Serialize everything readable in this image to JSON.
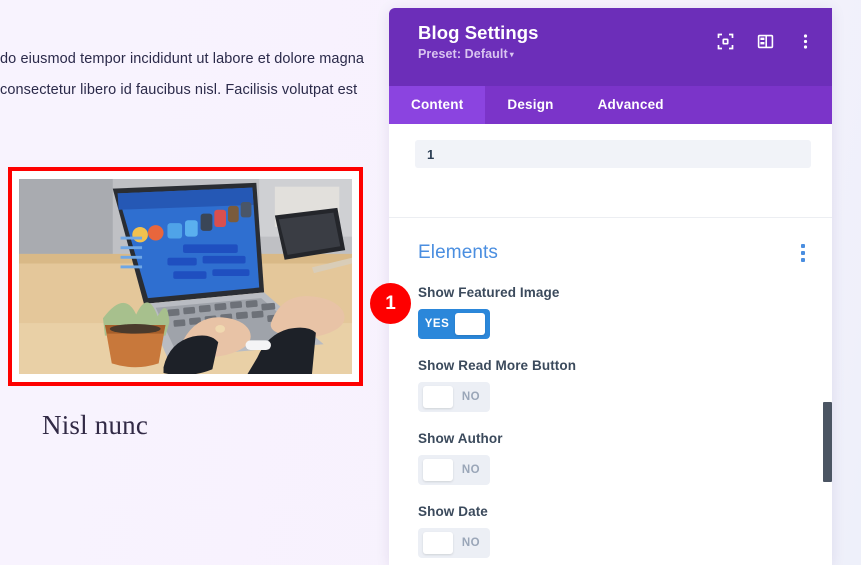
{
  "page": {
    "body_text_lines": [
      "do eiusmod tempor incididunt ut labore et dolore magna",
      "consectetur libero id faucibus nisl. Facilisis volutpat est"
    ],
    "post_title": "Nisl nunc",
    "featured_image_alt": "Person typing on a laptop at a wooden desk with a small potted succulent and a smartphone",
    "highlight_border_color": "#fe0000"
  },
  "panel": {
    "title": "Blog Settings",
    "preset_label": "Preset: Default",
    "preset_caret": "▾",
    "header_bg": "#6c2eb9",
    "header_icons": [
      {
        "name": "fullscreen-icon"
      },
      {
        "name": "layout-columns-icon"
      },
      {
        "name": "kebab-menu-icon"
      }
    ],
    "tabs": [
      {
        "label": "Content",
        "active": true
      },
      {
        "label": "Design",
        "active": false
      },
      {
        "label": "Advanced",
        "active": false
      }
    ],
    "post_count_field": {
      "value": "1",
      "placeholder": "1"
    },
    "elements_section": {
      "title": "Elements",
      "title_color": "#4a8ee0",
      "options": [
        {
          "label": "Show Featured Image",
          "state": "YES",
          "on": true
        },
        {
          "label": "Show Read More Button",
          "state": "NO",
          "on": false
        },
        {
          "label": "Show Author",
          "state": "NO",
          "on": false
        },
        {
          "label": "Show Date",
          "state": "NO",
          "on": false
        }
      ]
    },
    "toggle_on_color": "#2b87da",
    "toggle_off_color": "#eceff5"
  },
  "callout": {
    "number": "1",
    "color": "#fe0000"
  }
}
